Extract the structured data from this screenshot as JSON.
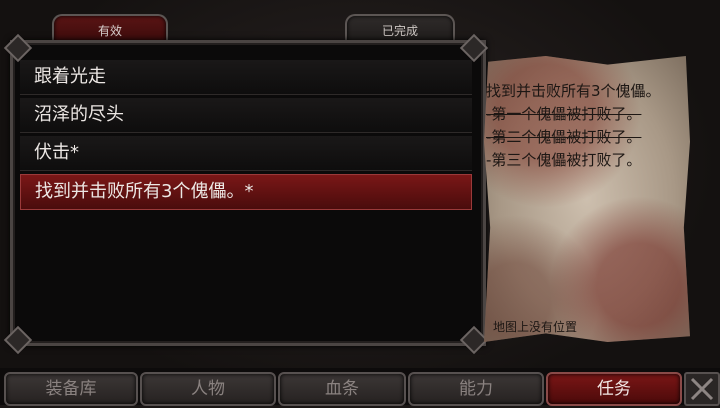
{
  "tabs": {
    "active": "有效",
    "completed": "已完成"
  },
  "quests": [
    {
      "label": "跟着光走"
    },
    {
      "label": "沼泽的尽头"
    },
    {
      "label": "伏击*"
    },
    {
      "label": "找到并击败所有3个傀儡。*"
    }
  ],
  "detail": {
    "title": "找到并击败所有3个傀儡。",
    "objectives": [
      "-第一个傀儡被打败了。",
      "-第二个傀儡被打败了。",
      "-第三个傀儡被打败了。"
    ],
    "map_note": "地图上没有位置"
  },
  "bottom_nav": [
    "装备库",
    "人物",
    "血条",
    "能力",
    "任务"
  ]
}
